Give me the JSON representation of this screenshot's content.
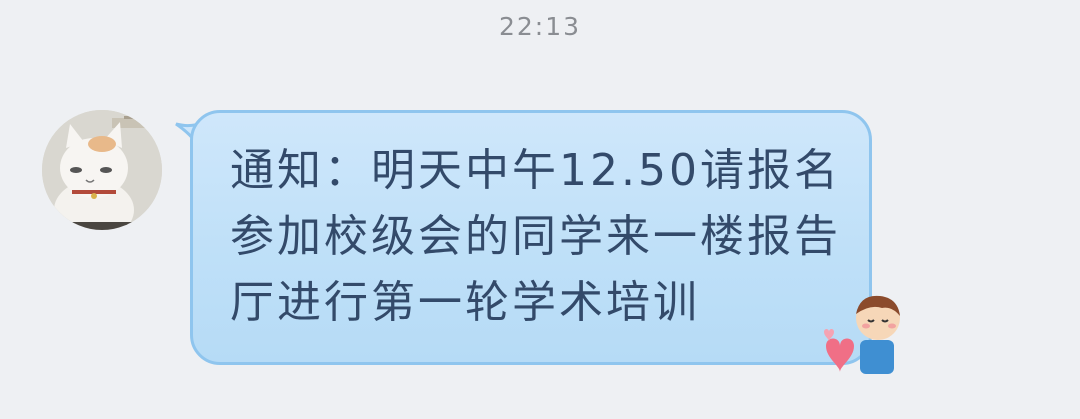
{
  "chat": {
    "timestamp": "22:13",
    "message": {
      "text": "通知：明天中午12.50请报名参加校级会的同学来一楼报告厅进行第一轮学术培训"
    },
    "avatar": "cat-avatar",
    "sticker": "boy-heart-sticker"
  },
  "colors": {
    "background": "#eef0f3",
    "bubble": "#c4e2fa",
    "bubble_border": "#8fc5ee",
    "message_text": "#334a6a",
    "timestamp_text": "#8a8d92"
  }
}
